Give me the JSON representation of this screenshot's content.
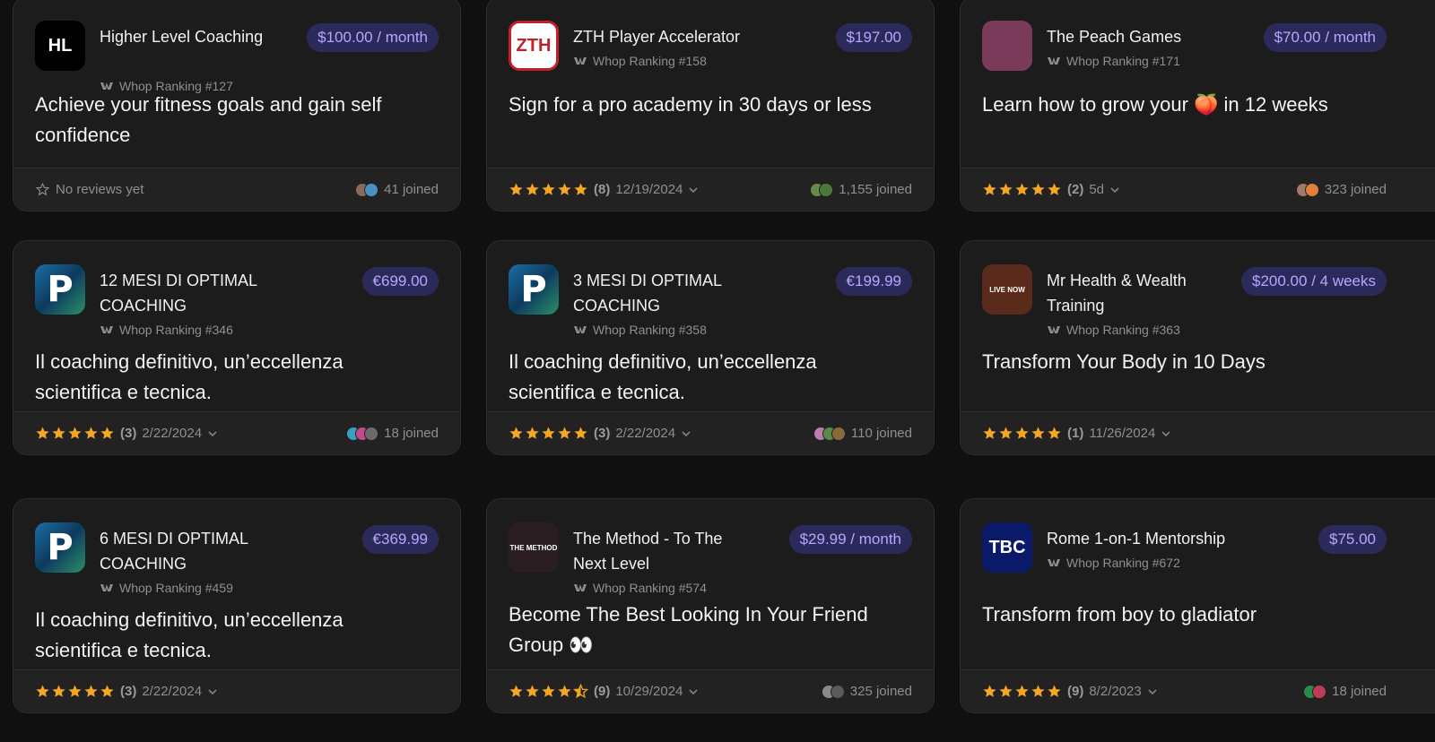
{
  "cards": [
    {
      "name": "Higher Level Coaching",
      "rank": "Whop Ranking #127",
      "price": "$100.00 / month",
      "headline": "Achieve your fitness goals and gain self confidence",
      "reviews": "No reviews yet",
      "joined": "41 joined",
      "logo": "HL",
      "logo_color": "#000000"
    },
    {
      "name": "ZTH Player Accelerator",
      "rank": "Whop Ranking #158",
      "price": "$197.00",
      "headline": "Sign for a pro academy in 30 days or less",
      "rating": 5,
      "count": "(8)",
      "date": "12/19/2024",
      "joined": "1,155 joined",
      "logo": "ZTH",
      "logo_color": "#ffffff"
    },
    {
      "name": "The Peach Games",
      "rank": "Whop Ranking #171",
      "price": "$70.00 / month",
      "headline": "Learn how to grow your 🍑 in 12 weeks",
      "rating": 5,
      "count": "(2)",
      "date": "5d",
      "joined": "323 joined",
      "logo": "",
      "logo_color": "#7a3a5a"
    },
    {
      "name": "12 MESI DI OPTIMAL COACHING",
      "rank": "Whop Ranking #346",
      "price": "€699.00",
      "headline": "Il coaching definitivo, un’eccellenza scientifica e tecnica.",
      "rating": 5,
      "count": "(3)",
      "date": "2/22/2024",
      "joined": "18 joined",
      "logo": "P",
      "logo_color": "#1a6fa8"
    },
    {
      "name": "3 MESI DI OPTIMAL COACHING",
      "rank": "Whop Ranking #358",
      "price": "€199.99",
      "headline": "Il coaching definitivo, un’eccellenza scientifica e tecnica.",
      "rating": 5,
      "count": "(3)",
      "date": "2/22/2024",
      "joined": "110 joined",
      "logo": "P",
      "logo_color": "#1a6fa8"
    },
    {
      "name": "Mr Health & Wealth Training",
      "rank": "Whop Ranking #363",
      "price": "$200.00 / 4 weeks",
      "headline": "Transform Your Body in 10 Days",
      "rating": 5,
      "count": "(1)",
      "date": "11/26/2024",
      "joined": "",
      "logo": "LIVE NOW",
      "logo_color": "#5a2a1a"
    },
    {
      "name": "6 MESI DI OPTIMAL COACHING",
      "rank": "Whop Ranking #459",
      "price": "€369.99",
      "headline": "Il coaching definitivo, un’eccellenza scientifica e tecnica.",
      "rating": 5,
      "count": "(3)",
      "date": "2/22/2024",
      "joined": "",
      "logo": "P",
      "logo_color": "#1a6fa8"
    },
    {
      "name": "The Method - To The Next Level",
      "rank": "Whop Ranking #574",
      "price": "$29.99 / month",
      "headline": "Become The Best Looking In Your Friend Group 👀",
      "rating": 4.5,
      "count": "(9)",
      "date": "10/29/2024",
      "joined": "325 joined",
      "logo": "THE METHOD",
      "logo_color": "#2a1e22"
    },
    {
      "name": "Rome 1-on-1 Mentorship",
      "rank": "Whop Ranking #672",
      "price": "$75.00",
      "headline": "Transform from boy to gladiator",
      "rating": 5,
      "count": "(9)",
      "date": "8/2/2023",
      "joined": "18 joined",
      "logo": "TBC",
      "logo_color": "#0a1a6a"
    }
  ],
  "colors": {
    "star": "#f5a623",
    "price_bg": "#2c2a5a",
    "price_text": "#b3a8ff"
  }
}
